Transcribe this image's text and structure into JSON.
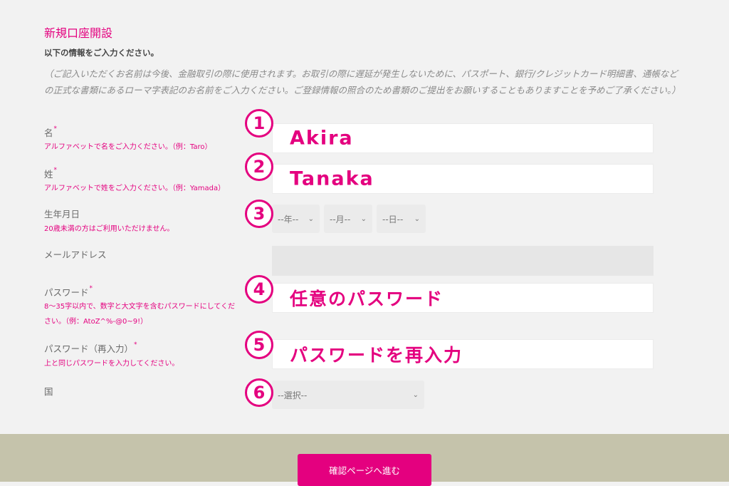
{
  "form": {
    "title": "新規口座開設",
    "intro": "以下の情報をご入力ください。",
    "notice": "（ご記入いただくお名前は今後、金融取引の際に使用されます。お取引の際に遅延が発生しないために、パスポート、銀行/クレジットカード明細書、通帳などの正式な書類にあるローマ字表記のお名前をご入力ください。ご登録情報の照合のため書類のご提出をお願いすることもありますことを予めご了承ください。）",
    "required_mark": "*",
    "first_name": {
      "label": "名",
      "hint": "アルファベットで名をご入力ください。（例：Taro）",
      "annotation": "Akira",
      "step": "1"
    },
    "last_name": {
      "label": "姓",
      "hint": "アルファベットで姓をご入力ください。（例：Yamada）",
      "annotation": "Tanaka",
      "step": "2"
    },
    "birthdate": {
      "label": "生年月日",
      "hint": "20歳未満の方はご利用いただけません。",
      "year_placeholder": "--年--",
      "month_placeholder": "--月--",
      "day_placeholder": "--日--",
      "step": "3"
    },
    "email": {
      "label": "メールアドレス"
    },
    "password": {
      "label": "パスワード",
      "hint_line1": "8～35字以内で、数字と大文字を含むパスワードにしてくだ",
      "hint_line2": "さい。（例：AtoZ^%-@0~9!）",
      "annotation": "任意のパスワード",
      "step": "4"
    },
    "password_confirm": {
      "label": "パスワード（再入力）",
      "hint": "上と同じパスワードを入力してください。",
      "annotation": "パスワードを再入力",
      "step": "5"
    },
    "country": {
      "label": "国",
      "placeholder": "--選択--",
      "step": "6"
    },
    "submit_label": "確認ページへ進む"
  },
  "icons": {
    "chevron": "chevron-down-icon"
  },
  "colors": {
    "accent": "#e4007f",
    "footer": "#c5c3ab",
    "background": "#f2f2f2"
  }
}
